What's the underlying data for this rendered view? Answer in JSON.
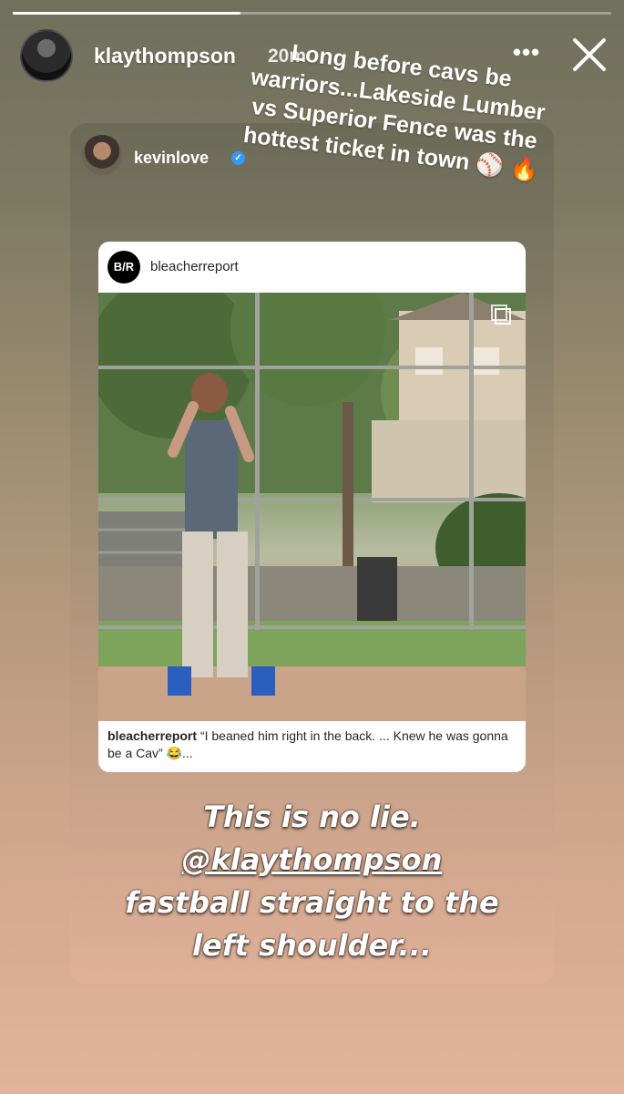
{
  "story": {
    "progress": 0.38,
    "user": "klaythompson",
    "time": "20m",
    "more_label": "•••",
    "close_icon": "close-icon",
    "caption": "Long before cavs be warriors...Lakeside Lumber vs Superior Fence was the hottest ticket in town ⚾ 🔥"
  },
  "reshare": {
    "user": "kevinlove",
    "verified_glyph": "✓",
    "post": {
      "account": "bleacherreport",
      "logo_text": "B/R",
      "caption_user": "bleacherreport",
      "caption_text": " “I beaned him right in the back. ... Knew he was gonna be a Cav” 😂..."
    },
    "overlay": {
      "line1": "This is no lie.",
      "line2": "@klaythompson",
      "line3": "fastball straight to the",
      "line4": "left shoulder..."
    }
  },
  "colors": {
    "verified_blue": "#3897f0",
    "card_bg": "#7a7560"
  }
}
